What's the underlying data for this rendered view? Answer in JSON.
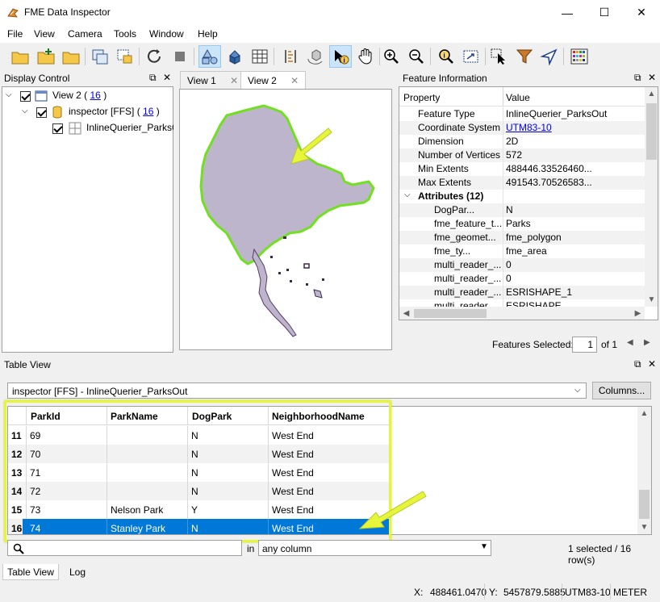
{
  "window": {
    "title": "FME Data Inspector",
    "minimize": "—",
    "maximize": "☐",
    "close": "✕"
  },
  "menu": [
    "File",
    "View",
    "Camera",
    "Tools",
    "Window",
    "Help"
  ],
  "display_control": {
    "title": "Display Control",
    "tree": [
      {
        "label": "View 2 (",
        "link": "16",
        "suffix": ")"
      },
      {
        "label": "inspector [FFS] (",
        "link": "16",
        "suffix": ")"
      },
      {
        "label": "InlineQuerier_ParksOut"
      }
    ]
  },
  "views": {
    "tabs": [
      "View 1",
      "View 2"
    ],
    "active": "View 2"
  },
  "feature_info": {
    "title": "Feature Information",
    "headers": [
      "Property",
      "Value"
    ],
    "rows": [
      {
        "property": "Feature Type",
        "value": "InlineQuerier_ParksOut"
      },
      {
        "property": "Coordinate System",
        "value": "UTM83-10"
      },
      {
        "property": "Dimension",
        "value": "2D"
      },
      {
        "property": "Number of Vertices",
        "value": "572"
      },
      {
        "property": "Min Extents",
        "value": "488446.33526460..."
      },
      {
        "property": "Max Extents",
        "value": "491543.70526583..."
      }
    ],
    "attributes_label": "Attributes (12)",
    "attributes": [
      {
        "property": "DogPar...",
        "value": "N"
      },
      {
        "property": "fme_feature_t...",
        "value": "Parks"
      },
      {
        "property": "fme_geomet...",
        "value": "fme_polygon"
      },
      {
        "property": "fme_ty...",
        "value": "fme_area"
      },
      {
        "property": "multi_reader_...",
        "value": "0"
      },
      {
        "property": "multi_reader_...",
        "value": "0"
      },
      {
        "property": "multi_reader_...",
        "value": "ESRISHAPE_1"
      },
      {
        "property": "multi_reader_...",
        "value": "ESRISHAPE"
      }
    ],
    "features_selected_label": "Features Selected:",
    "features_selected_value": "1",
    "of_label": "of 1"
  },
  "table_view": {
    "title": "Table View",
    "source": "inspector [FFS] - InlineQuerier_ParksOut",
    "columns_button": "Columns...",
    "headers": [
      "ParkId",
      "ParkName",
      "DogPark",
      "NeighborhoodName"
    ],
    "rows": [
      {
        "num": "11",
        "ParkId": "69",
        "ParkName": "",
        "DogPark": "N",
        "NeighborhoodName": "West End"
      },
      {
        "num": "12",
        "ParkId": "70",
        "ParkName": "",
        "DogPark": "N",
        "NeighborhoodName": "West End"
      },
      {
        "num": "13",
        "ParkId": "71",
        "ParkName": "",
        "DogPark": "N",
        "NeighborhoodName": "West End"
      },
      {
        "num": "14",
        "ParkId": "72",
        "ParkName": "",
        "DogPark": "N",
        "NeighborhoodName": "West End"
      },
      {
        "num": "15",
        "ParkId": "73",
        "ParkName": "Nelson Park",
        "DogPark": "Y",
        "NeighborhoodName": "West End"
      },
      {
        "num": "16",
        "ParkId": "74",
        "ParkName": "Stanley Park",
        "DogPark": "N",
        "NeighborhoodName": "West End"
      }
    ],
    "search_in_label": "in",
    "column_filter": "any column",
    "selection_status": "1 selected / 16 row(s)",
    "bottom_tabs": [
      "Table View",
      "Log"
    ]
  },
  "status": {
    "x_label": "X:",
    "x": "488461.0470",
    "y_label": "Y:",
    "y": "5457879.5885",
    "crs": "UTM83-10",
    "units": "METER"
  },
  "colors": {
    "selection": "#0078d7",
    "highlight": "#e6f53a",
    "polygon_fill": "#bdb5cc",
    "polygon_outline": "#72e020"
  }
}
